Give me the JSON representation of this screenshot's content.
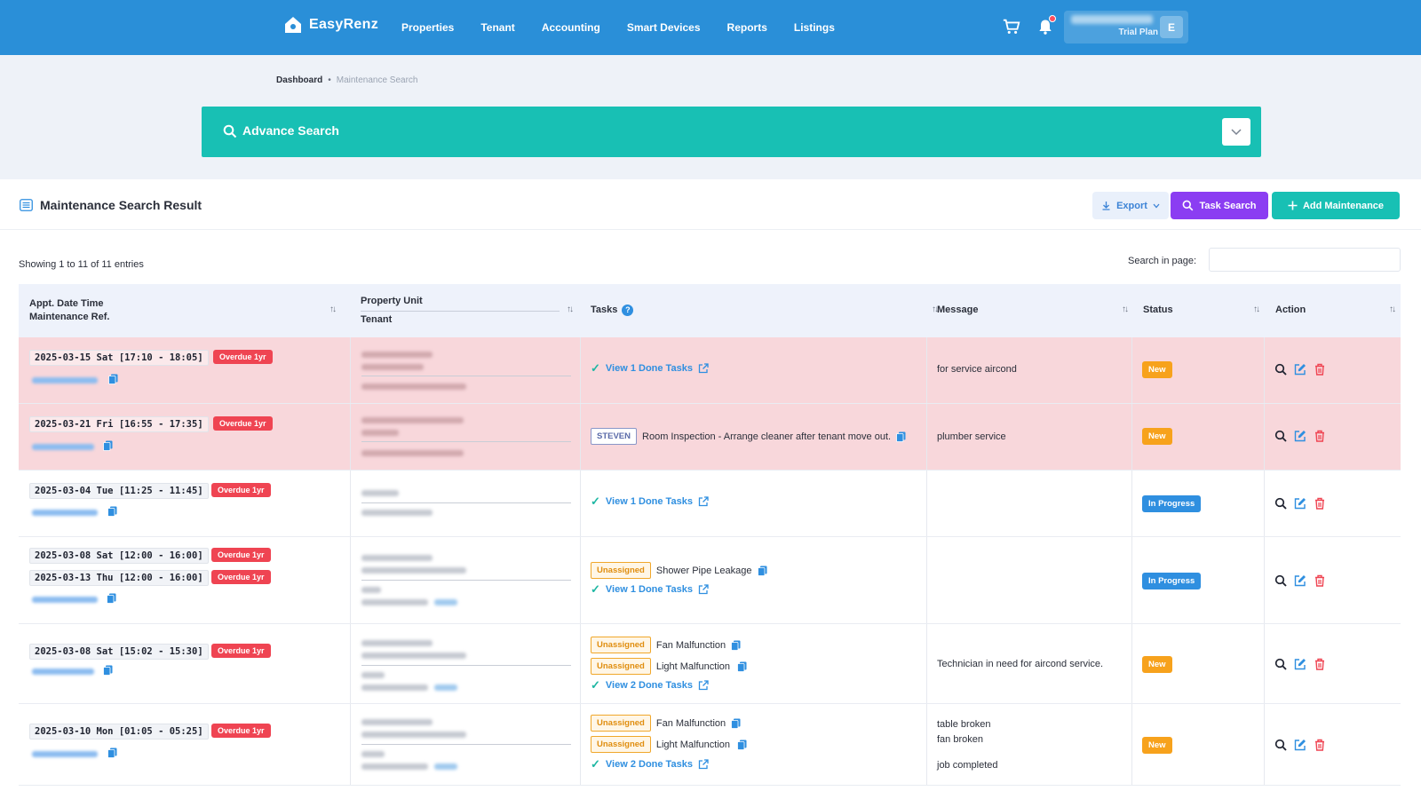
{
  "app": {
    "name": "EasyRenz",
    "nav": [
      "Properties",
      "Tenant",
      "Accounting",
      "Smart Devices",
      "Reports",
      "Listings"
    ],
    "user_plan": "Trial Plan",
    "user_initial": "E"
  },
  "breadcrumb": {
    "home": "Dashboard",
    "separator": "•",
    "current": "Maintenance Search"
  },
  "advance_search": {
    "title": "Advance Search"
  },
  "result": {
    "title": "Maintenance Search Result",
    "export_label": "Export",
    "task_search_label": "Task Search",
    "add_label": "Add Maintenance",
    "entries_info": "Showing 1 to 11 of 11 entries",
    "search_in_page_label": "Search in page:"
  },
  "table": {
    "headers": {
      "appt_line1": "Appt. Date Time",
      "appt_line2": "Maintenance Ref.",
      "property_unit": "Property Unit",
      "tenant": "Tenant",
      "tasks": "Tasks",
      "tasks_help": "?",
      "message": "Message",
      "status": "Status",
      "action": "Action"
    },
    "rows": [
      {
        "dates": [
          {
            "datetime": "2025-03-15 Sat [17:10 - 18:05]",
            "badge": "Overdue 1yr"
          }
        ],
        "tasks": {
          "done_label": "View 1 Done Tasks"
        },
        "message": "for service aircond",
        "status": "New"
      },
      {
        "dates": [
          {
            "datetime": "2025-03-21 Fri [16:55 - 17:35]",
            "badge": "Overdue 1yr"
          }
        ],
        "tasks": {
          "assignee": "STEVEN",
          "item": "Room Inspection - Arrange cleaner after tenant move out."
        },
        "message": "plumber service",
        "status": "New"
      },
      {
        "dates": [
          {
            "datetime": "2025-03-04 Tue [11:25 - 11:45]",
            "badge": "Overdue 1yr"
          }
        ],
        "tasks": {
          "done_label": "View 1 Done Tasks"
        },
        "message": "",
        "status": "In Progress"
      },
      {
        "dates": [
          {
            "datetime": "2025-03-08 Sat [12:00 - 16:00]",
            "badge": "Overdue 1yr"
          },
          {
            "datetime": "2025-03-13 Thu [12:00 - 16:00]",
            "badge": "Overdue 1yr"
          }
        ],
        "tasks": {
          "items": [
            {
              "tag": "Unassigned",
              "name": "Shower Pipe Leakage"
            }
          ],
          "done_label": "View 1 Done Tasks"
        },
        "message": "",
        "status": "In Progress"
      },
      {
        "dates": [
          {
            "datetime": "2025-03-08 Sat [15:02 - 15:30]",
            "badge": "Overdue 1yr"
          }
        ],
        "tasks": {
          "items": [
            {
              "tag": "Unassigned",
              "name": "Fan Malfunction"
            },
            {
              "tag": "Unassigned",
              "name": "Light Malfunction"
            }
          ],
          "done_label": "View 2 Done Tasks"
        },
        "message": "Technician in need for aircond service.",
        "status": "New"
      },
      {
        "dates": [
          {
            "datetime": "2025-03-10 Mon [01:05 - 05:25]",
            "badge": "Overdue 1yr"
          }
        ],
        "tasks": {
          "items": [
            {
              "tag": "Unassigned",
              "name": "Fan Malfunction"
            },
            {
              "tag": "Unassigned",
              "name": "Light Malfunction"
            }
          ],
          "done_label": "View 2 Done Tasks"
        },
        "message_lines": [
          "table broken",
          "fan broken",
          "job completed"
        ],
        "status": "New"
      }
    ]
  },
  "colors": {
    "topbar": "#2a8fd8",
    "teal": "#18c0b4",
    "purple": "#8b3df2",
    "overdue_row": "#f8d7db",
    "overdue_badge": "#ef4452",
    "status_new": "#f7a21c",
    "status_in_progress": "#2f8fe0"
  },
  "icons": [
    "home-logo-icon",
    "cart-icon",
    "bell-icon",
    "search-icon",
    "chevron-down-icon",
    "list-icon",
    "download-icon",
    "plus-icon",
    "sort-icon",
    "help-icon",
    "copy-icon",
    "check-icon",
    "external-link-icon",
    "view-icon",
    "edit-icon",
    "delete-icon"
  ]
}
